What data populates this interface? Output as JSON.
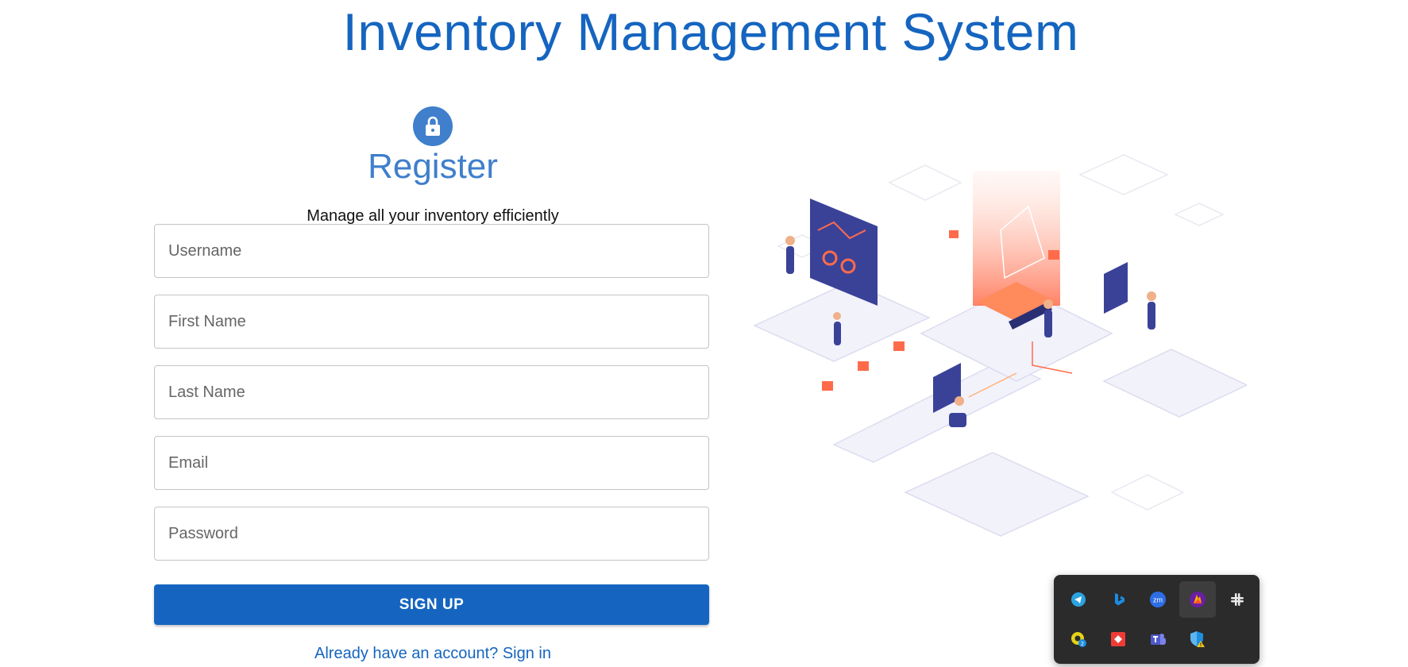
{
  "header": {
    "title": "Inventory Management System"
  },
  "form": {
    "title": "Register",
    "subtitle": "Manage all your inventory efficiently",
    "fields": {
      "username": {
        "placeholder": "Username",
        "value": ""
      },
      "first_name": {
        "placeholder": "First Name",
        "value": ""
      },
      "last_name": {
        "placeholder": "Last Name",
        "value": ""
      },
      "email": {
        "placeholder": "Email",
        "value": ""
      },
      "password": {
        "placeholder": "Password",
        "value": ""
      }
    },
    "submit_label": "SIGN UP",
    "signin_link": "Already have an account? Sign in"
  },
  "colors": {
    "primary": "#1565c0",
    "avatar": "#3f7fcc",
    "illustration_accent": "#ff6b4a",
    "illustration_navy": "#3a4298"
  },
  "tray": {
    "icons": [
      {
        "name": "telegram-icon"
      },
      {
        "name": "bing-icon"
      },
      {
        "name": "zoom-icon"
      },
      {
        "name": "firebase-icon",
        "selected": true
      },
      {
        "name": "slack-icon"
      },
      {
        "name": "greenshot-icon",
        "badge": "2"
      },
      {
        "name": "anydesk-icon"
      },
      {
        "name": "teams-icon"
      },
      {
        "name": "windows-security-icon",
        "status": "warning"
      }
    ]
  }
}
